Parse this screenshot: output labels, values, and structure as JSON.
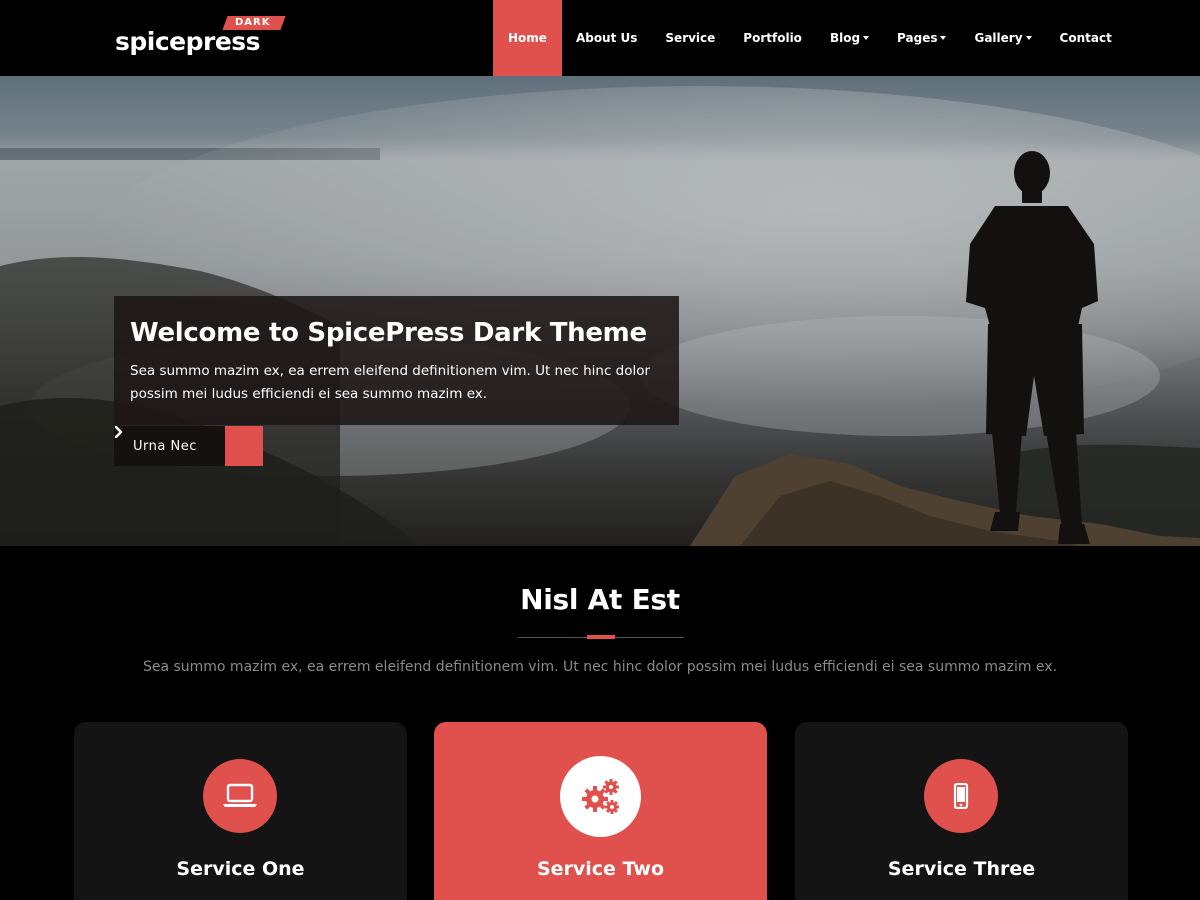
{
  "brand": {
    "name": "spicepress",
    "badge": "DARK",
    "accent_color": "#e0514e"
  },
  "nav": {
    "items": [
      {
        "label": "Home",
        "active": true
      },
      {
        "label": "About Us"
      },
      {
        "label": "Service"
      },
      {
        "label": "Portfolio"
      },
      {
        "label": "Blog",
        "dropdown": true
      },
      {
        "label": "Pages",
        "dropdown": true
      },
      {
        "label": "Gallery",
        "dropdown": true
      },
      {
        "label": "Contact"
      }
    ]
  },
  "hero": {
    "title": "Welcome to SpicePress Dark Theme",
    "text": "Sea summo mazim ex, ea errem eleifend definitionem vim. Ut nec hinc dolor possim mei ludus efficiendi ei sea summo mazim ex.",
    "button_label": "Urna Nec",
    "button_icon": "chevron-right-icon"
  },
  "services": {
    "title": "Nisl At Est",
    "description": "Sea summo mazim ex, ea errem eleifend definitionem vim. Ut nec hinc dolor possim mei ludus efficiendi ei sea summo mazim ex.",
    "cards": [
      {
        "title": "Service One",
        "icon": "laptop-icon"
      },
      {
        "title": "Service Two",
        "icon": "gears-icon",
        "highlighted": true
      },
      {
        "title": "Service Three",
        "icon": "mobile-icon"
      }
    ]
  }
}
